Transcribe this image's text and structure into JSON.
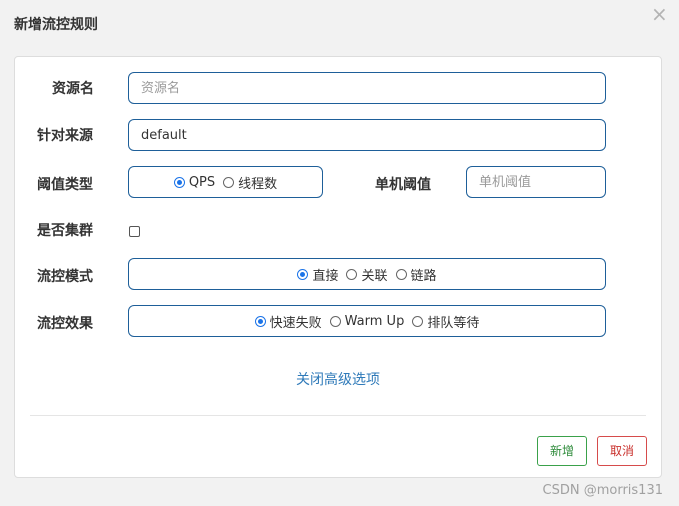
{
  "dialog": {
    "title": "新增流控规则",
    "close_icon": "×"
  },
  "form": {
    "resource_name": {
      "label": "资源名",
      "value": "",
      "placeholder": "资源名"
    },
    "limit_app": {
      "label": "针对来源",
      "value": "default",
      "placeholder": ""
    },
    "threshold_type": {
      "label": "阈值类型",
      "options": [
        {
          "label": "QPS",
          "checked": true
        },
        {
          "label": "线程数",
          "checked": false
        }
      ]
    },
    "single_threshold": {
      "label": "单机阈值",
      "value": "",
      "placeholder": "单机阈值"
    },
    "cluster": {
      "label": "是否集群",
      "checked": false
    },
    "control_mode": {
      "label": "流控模式",
      "options": [
        {
          "label": "直接",
          "checked": true
        },
        {
          "label": "关联",
          "checked": false
        },
        {
          "label": "链路",
          "checked": false
        }
      ]
    },
    "control_effect": {
      "label": "流控效果",
      "options": [
        {
          "label": "快速失败",
          "checked": true
        },
        {
          "label": "Warm Up",
          "checked": false
        },
        {
          "label": "排队等待",
          "checked": false
        }
      ]
    },
    "advanced_link": "关闭高级选项"
  },
  "buttons": {
    "add": "新增",
    "cancel": "取消"
  },
  "watermark": "CSDN @morris131"
}
